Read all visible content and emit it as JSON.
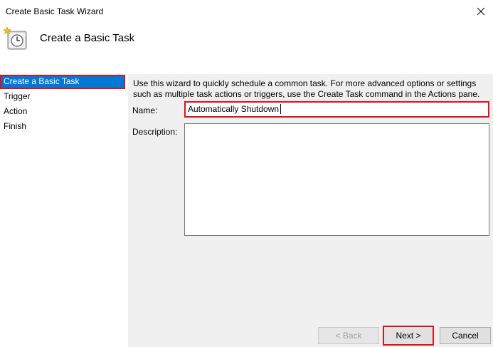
{
  "window": {
    "title": "Create Basic Task Wizard",
    "close_icon": "close-icon"
  },
  "header": {
    "icon": "task-scheduler-clock-icon",
    "heading": "Create a Basic Task"
  },
  "sidebar": {
    "items": [
      {
        "label": "Create a Basic Task",
        "active": true
      },
      {
        "label": "Trigger",
        "active": false
      },
      {
        "label": "Action",
        "active": false
      },
      {
        "label": "Finish",
        "active": false
      }
    ]
  },
  "main": {
    "intro": "Use this wizard to quickly schedule a common task.  For more advanced options or settings such as multiple task actions or triggers, use the Create Task command in the Actions pane.",
    "name_label": "Name:",
    "name_value": "Automatically Shutdown",
    "description_label": "Description:",
    "description_value": ""
  },
  "buttons": {
    "back": "< Back",
    "next": "Next >",
    "cancel": "Cancel"
  },
  "colors": {
    "selection": "#0078d7",
    "highlight": "#e0101f",
    "content_bg": "#f0f0f0"
  }
}
